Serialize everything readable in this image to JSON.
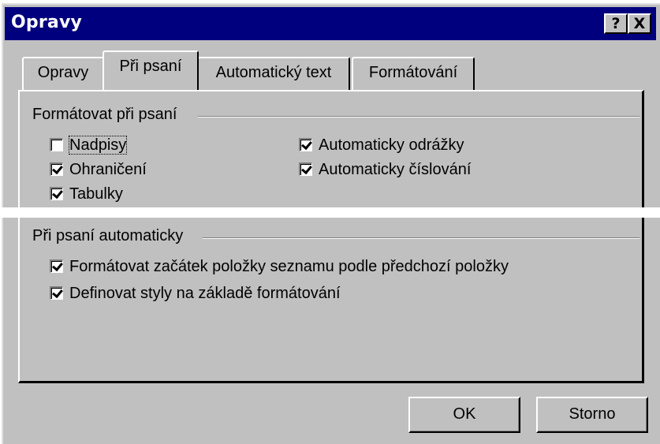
{
  "window": {
    "title": "Opravy",
    "help_button": "?",
    "close_button": "X"
  },
  "tabs": [
    {
      "label": "Opravy",
      "active": false
    },
    {
      "label": "Při psaní",
      "active": true
    },
    {
      "label": "Automatický text",
      "active": false
    },
    {
      "label": "Formátování",
      "active": false
    }
  ],
  "group1": {
    "label": "Formátovat při psaní",
    "items": [
      {
        "label": "Nadpisy",
        "checked": false
      },
      {
        "label": "Ohraničení",
        "checked": true
      },
      {
        "label": "Tabulky",
        "checked": true
      },
      {
        "label": "Automaticky odrážky",
        "checked": true
      },
      {
        "label": "Automaticky číslování",
        "checked": true
      }
    ]
  },
  "group2": {
    "label": "Při psaní automaticky",
    "items": [
      {
        "label": "Formátovat začátek položky seznamu podle předchozí položky",
        "checked": true
      },
      {
        "label": "Definovat styly na základě formátování",
        "checked": true
      }
    ]
  },
  "buttons": {
    "ok": "OK",
    "cancel": "Storno"
  }
}
